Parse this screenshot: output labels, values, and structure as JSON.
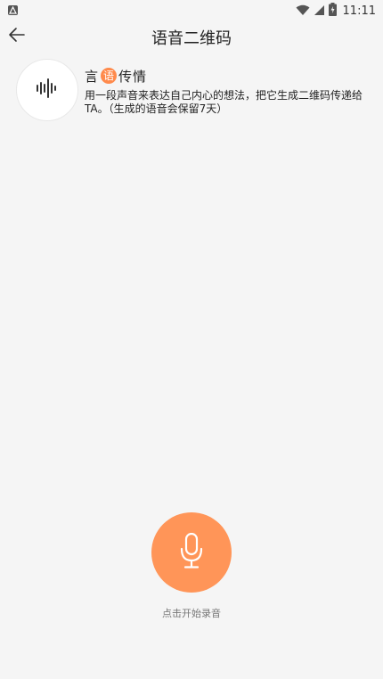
{
  "status_bar": {
    "time": "11:11",
    "icons": [
      "notification-icon",
      "wifi-icon",
      "signal-icon",
      "battery-icon"
    ]
  },
  "app_bar": {
    "title": "语音二维码",
    "back_icon": "arrow-left-icon"
  },
  "header": {
    "logo_icon": "sound-wave-icon",
    "brand": {
      "before": "言",
      "highlight": "语",
      "after": "传情"
    },
    "description": "用一段声音来表达自己内心的想法，把它生成二维码传递给TA。（生成的语音会保留7天）"
  },
  "recorder": {
    "mic_icon": "microphone-icon",
    "label": "点击开始录音"
  },
  "colors": {
    "accent": "#ff9558",
    "background": "#f5f5f5"
  }
}
